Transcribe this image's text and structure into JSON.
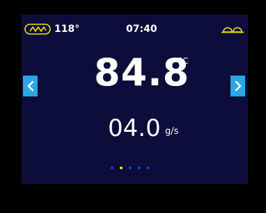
{
  "status_bar": {
    "heater_icon": "heater-coil-icon",
    "water_temperature": "118°",
    "time": "07:40",
    "cups_icon": "cup-tray-icon",
    "accent_color": "#f2e600"
  },
  "main": {
    "temperature_value": "84.8",
    "temperature_unit": "°C",
    "flow_value": "04.0",
    "flow_unit": "g/s"
  },
  "navigation": {
    "prev_icon": "chevron-left-icon",
    "next_icon": "chevron-right-icon",
    "button_color": "#2aa8e6"
  },
  "pagination": {
    "page_count": 5,
    "active_page": 2,
    "dot_color": "#1a3fe0",
    "active_dot_color": "#f2e600"
  },
  "colors": {
    "screen_background": "#0d0d3c",
    "bezel": "#000000",
    "text": "#ffffff"
  }
}
